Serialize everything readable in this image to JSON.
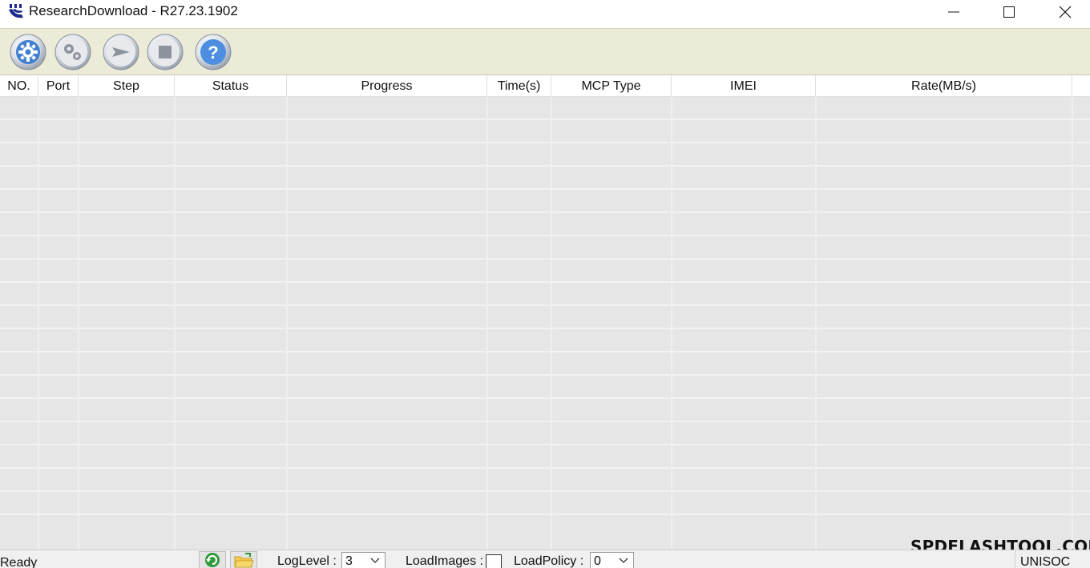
{
  "window": {
    "title": "ResearchDownload - R27.23.1902",
    "controls": {
      "minimize": "minimize-icon",
      "maximize": "maximize-icon",
      "close": "close-icon"
    }
  },
  "toolbar": {
    "buttons": [
      {
        "name": "load-packet",
        "icon": "gear-icon"
      },
      {
        "name": "settings",
        "icon": "double-gear-icon"
      },
      {
        "name": "start-download",
        "icon": "play-icon"
      },
      {
        "name": "stop-download",
        "icon": "stop-icon"
      },
      {
        "name": "help",
        "icon": "question-icon"
      }
    ]
  },
  "grid": {
    "columns": [
      "NO.",
      "Port",
      "Step",
      "Status",
      "Progress",
      "Time(s)",
      "MCP Type",
      "IMEI",
      "Rate(MB/s)"
    ],
    "rows": []
  },
  "watermark": "SPDFLASHTOOL.COM",
  "statusbar": {
    "status_text": "Ready",
    "refresh_icon": "refresh-icon",
    "open_folder_icon": "folder-icon",
    "loglevel_label": "LogLevel :",
    "loglevel_value": "3",
    "loadimages_label": "LoadImages :",
    "loadimages_checked": false,
    "loadpolicy_label": "LoadPolicy :",
    "loadpolicy_value": "0",
    "vendor": "UNISOC"
  },
  "colors": {
    "toolbar_bg": "#ecebd8",
    "grid_bg": "#e6e6e6",
    "button_blue": "#3f7fd0"
  }
}
